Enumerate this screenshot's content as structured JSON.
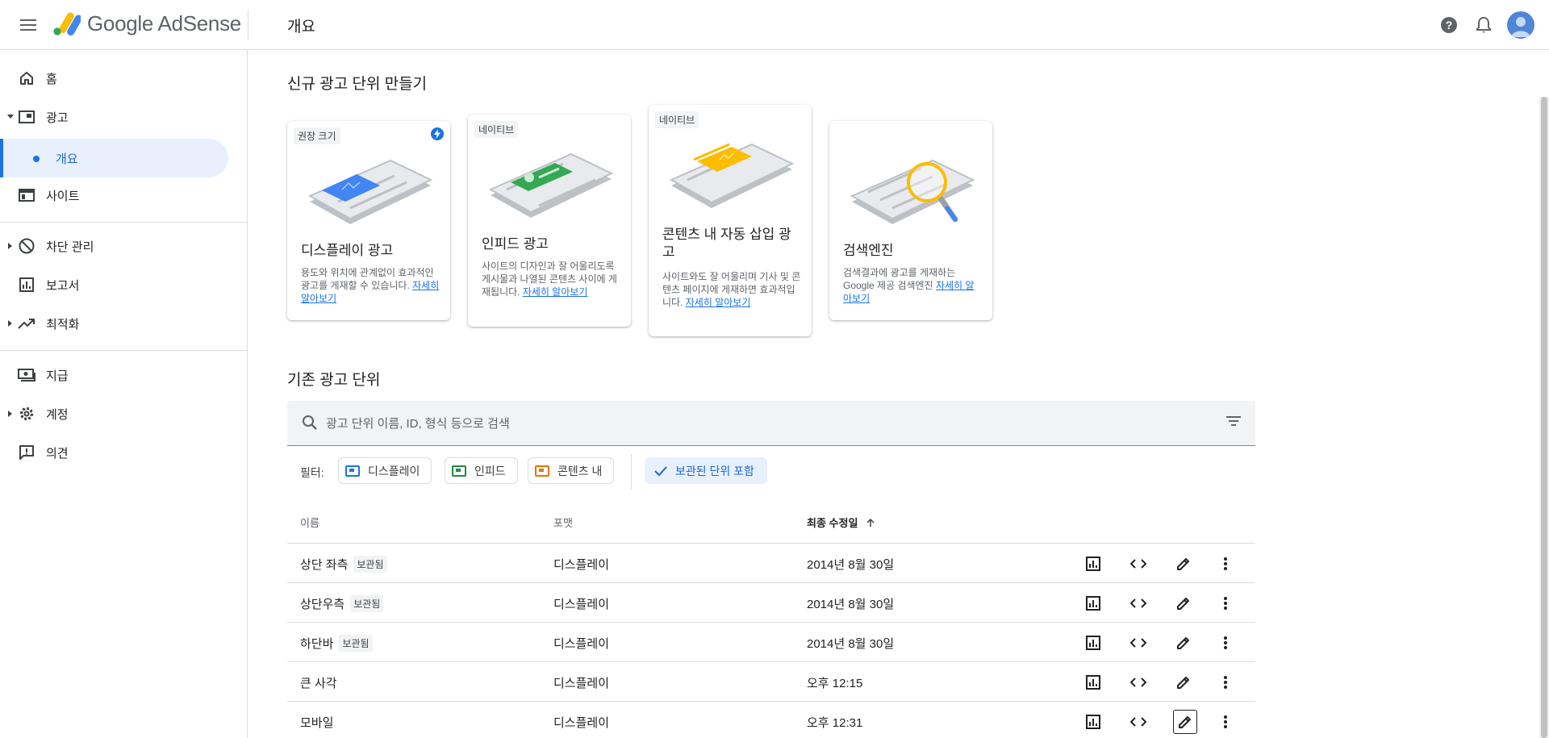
{
  "header": {
    "product_name": "Google AdSense",
    "page_title": "개요"
  },
  "sidebar": {
    "items": [
      {
        "label": "홈",
        "icon": "home-icon"
      },
      {
        "label": "광고",
        "icon": "ads-icon"
      },
      {
        "label": "개요",
        "icon": "dot-icon"
      },
      {
        "label": "사이트",
        "icon": "sites-icon"
      },
      {
        "label": "차단 관리",
        "icon": "block-icon"
      },
      {
        "label": "보고서",
        "icon": "reports-icon"
      },
      {
        "label": "최적화",
        "icon": "optimization-icon"
      },
      {
        "label": "지급",
        "icon": "payments-icon"
      },
      {
        "label": "계정",
        "icon": "gear-icon"
      },
      {
        "label": "의견",
        "icon": "feedback-icon"
      }
    ]
  },
  "create_section": {
    "title": "신규 광고 단위 만들기",
    "learn_more": "자세히 알아보기",
    "cards": [
      {
        "chip": "권장 크기",
        "title": "디스플레이 광고",
        "desc": "용도와 위치에 관계없이 효과적인 광고를 게재할 수 있습니다."
      },
      {
        "chip": "네이티브",
        "title": "인피드 광고",
        "desc": "사이트의 디자인과 잘 어울리도록 게시물과 나열된 콘텐츠 사이에 게재됩니다."
      },
      {
        "chip": "네이티브",
        "title": "콘텐츠 내 자동 삽입 광고",
        "desc": "사이트와도 잘 어울리며 기사 및 콘텐츠 페이지에 게재하면 효과적입니다."
      },
      {
        "chip": "",
        "title": "검색엔진",
        "desc": "검색결과에 광고를 게재하는 Google 제공 검색엔진"
      }
    ]
  },
  "existing_section": {
    "title": "기존 광고 단위",
    "search_placeholder": "광고 단위 이름, ID, 형식 등으로 검색",
    "filter_label": "필터:",
    "filters": [
      "디스플레이",
      "인피드",
      "콘텐츠 내"
    ],
    "archived_toggle": "보관된 단위 포함",
    "columns": [
      "이름",
      "포맷",
      "최종 수정일"
    ],
    "rows": [
      {
        "name": "상단 좌측",
        "badge": "보관됨",
        "format": "디스플레이",
        "modified": "2014년 8월 30일"
      },
      {
        "name": "상단우측",
        "badge": "보관됨",
        "format": "디스플레이",
        "modified": "2014년 8월 30일"
      },
      {
        "name": "하단바",
        "badge": "보관됨",
        "format": "디스플레이",
        "modified": "2014년 8월 30일"
      },
      {
        "name": "큰 사각",
        "badge": "",
        "format": "디스플레이",
        "modified": "오후 12:15"
      },
      {
        "name": "모바일",
        "badge": "",
        "format": "디스플레이",
        "modified": "오후 12:31"
      }
    ]
  },
  "colors": {
    "accent": "#1a73e8",
    "selected_bg": "#e8f0fe",
    "display_chip": "#1a73e8",
    "infeed_chip": "#1e8e3e",
    "incontent_chip": "#e37400"
  }
}
